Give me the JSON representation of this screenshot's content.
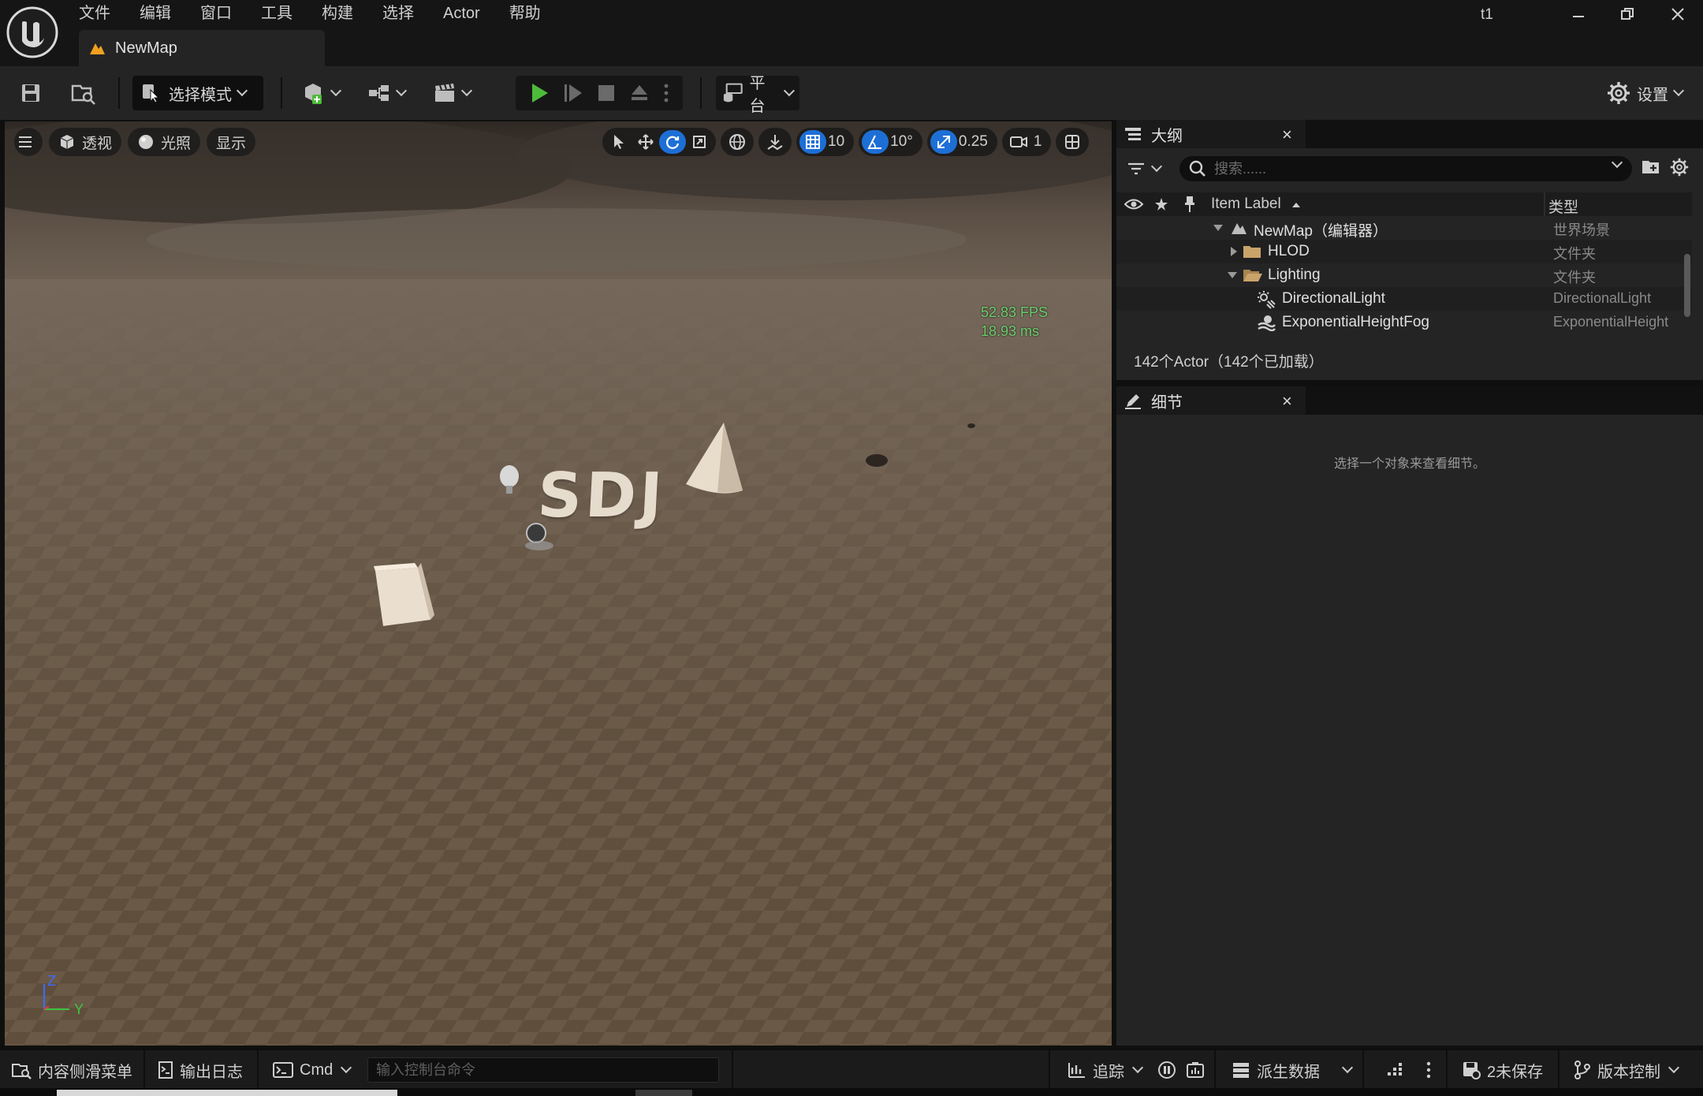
{
  "app": {
    "project_name": "t1",
    "map_tab": "NewMap",
    "menu": [
      "文件",
      "编辑",
      "窗口",
      "工具",
      "构建",
      "选择",
      "Actor",
      "帮助"
    ]
  },
  "toolbar": {
    "mode_select": "选择模式",
    "platform": "平台",
    "settings": "设置"
  },
  "viewport": {
    "perspective": "透视",
    "lighting": "光照",
    "show": "显示",
    "grid_snap": "10",
    "rotation_snap": "10°",
    "scale_snap": "0.25",
    "camera_speed": "1",
    "fps": "52.83 FPS",
    "frame_ms": "18.93 ms",
    "scene_text": "SDJ",
    "axis_z": "Z",
    "axis_y": "Y"
  },
  "outliner": {
    "tab_title": "大纲",
    "search_placeholder": "搜索......",
    "col_label": "Item Label",
    "col_type": "类型",
    "rows": [
      {
        "name": "NewMap（编辑器）",
        "type": "世界场景"
      },
      {
        "name": "HLOD",
        "type": "文件夹"
      },
      {
        "name": "Lighting",
        "type": "文件夹"
      },
      {
        "name": "DirectionalLight",
        "type": "DirectionalLight"
      },
      {
        "name": "ExponentialHeightFog",
        "type": "ExponentialHeight"
      }
    ],
    "actor_count": "142个Actor（142个已加载）"
  },
  "details": {
    "tab_title": "细节",
    "empty_text": "选择一个对象来查看细节。"
  },
  "statusbar": {
    "content_drawer": "内容侧滑菜单",
    "output_log": "输出日志",
    "cmd": "Cmd",
    "console_placeholder": "输入控制台命令",
    "trace": "追踪",
    "derived_data": "派生数据",
    "unsaved": "2未保存",
    "source_control": "版本控制"
  },
  "colors": {
    "accent": "#1d6fd6",
    "play_green": "#4dbb3a",
    "fps_green": "#6dcf6d"
  }
}
